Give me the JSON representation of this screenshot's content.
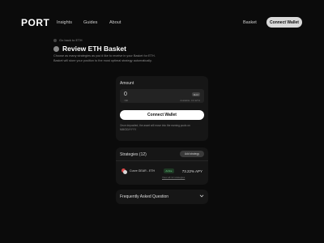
{
  "nav": {
    "logo": "PORT",
    "links": [
      "Insights",
      "Guides",
      "About"
    ],
    "basket": "Basket",
    "connect": "Connect Wallet"
  },
  "header": {
    "back_label": "Go back to ETH",
    "title": "Review ETH Basket",
    "description": "Choose as many strategies as you'd like to receive in your Basket for ETH. Basket will store your position to the most optimal strategy automatically."
  },
  "amount_card": {
    "label": "Amount",
    "value": "0",
    "usd": "=$0",
    "max_label": "MAX",
    "available": "Available: 0.0 ETH",
    "connect_label": "Connect Wallet",
    "note": "Once deposited, the asset will move into the earning pools on MM/DD/YYYY"
  },
  "strategies": {
    "title": "Strategies (12)",
    "add_label": "Add strategy",
    "rows": [
      {
        "name": "Curve GEAR - ETH",
        "status": "Active",
        "apy": "73.22% APY",
        "link": "View all 12 strategies"
      }
    ]
  },
  "faq": {
    "title": "Frequently Asked Question"
  },
  "colors": {
    "background": "#0b0b0b",
    "card": "#161616",
    "accent_button": "#ffffff",
    "active_badge": "#6fd98b"
  }
}
